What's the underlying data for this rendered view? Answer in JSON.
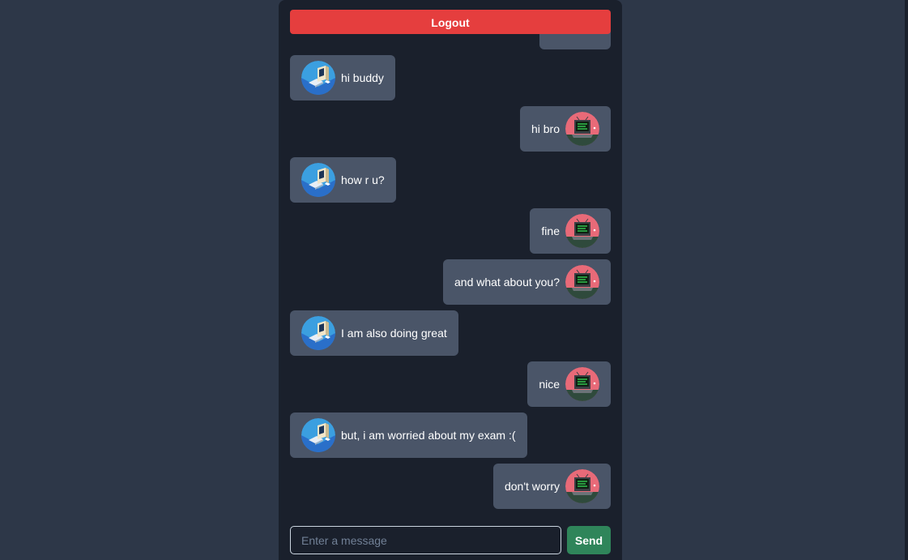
{
  "header": {
    "logout_label": "Logout"
  },
  "colors": {
    "page_background": "#2d3748",
    "panel_background": "#1a202c",
    "bubble": "#4a5568",
    "logout": "#e53e3e",
    "send": "#2f855a"
  },
  "avatars": {
    "other_user": "blue-computer-avatar-icon",
    "current_user": "red-terminal-avatar-icon"
  },
  "messages": [
    {
      "text": "hi buddy",
      "sender": "other"
    },
    {
      "text": "hi bro",
      "sender": "self"
    },
    {
      "text": "how r u?",
      "sender": "other"
    },
    {
      "text": "fine",
      "sender": "self"
    },
    {
      "text": "and what about you?",
      "sender": "self"
    },
    {
      "text": "I am also doing great",
      "sender": "other"
    },
    {
      "text": "nice",
      "sender": "self"
    },
    {
      "text": "but, i am worried about my exam :(",
      "sender": "other"
    },
    {
      "text": "don't worry",
      "sender": "self"
    }
  ],
  "composer": {
    "placeholder": "Enter a message",
    "value": "",
    "send_label": "Send"
  }
}
